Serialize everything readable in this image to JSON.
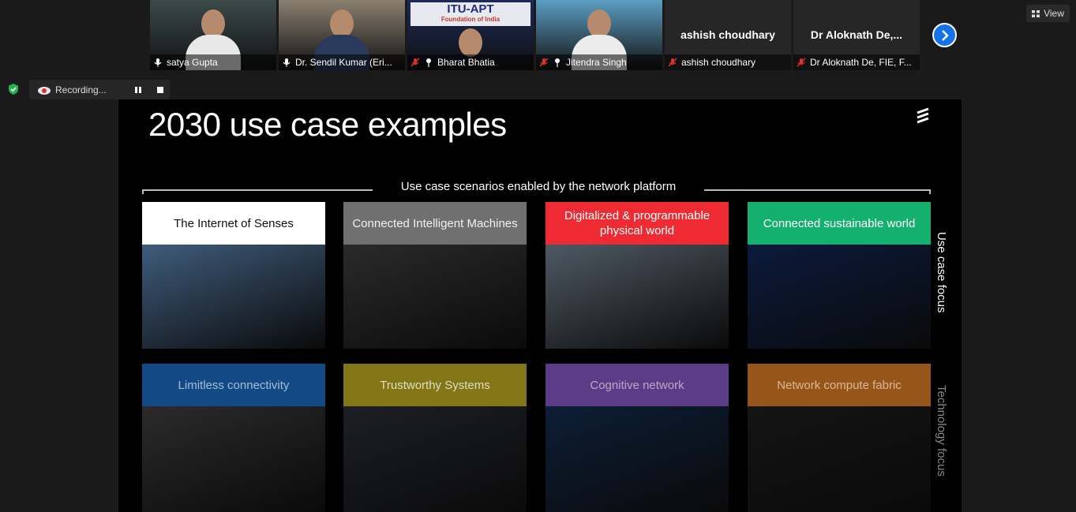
{
  "participants": [
    {
      "name": "satya Gupta",
      "type": "video",
      "active": true,
      "bg": "#3c4a4a",
      "shirt": "#e8e8e8"
    },
    {
      "name": "Dr. Sendil Kumar (Eri...",
      "type": "video",
      "active": false,
      "bg": "#8a8070",
      "shirt": "#2a3a5c"
    },
    {
      "name": "Bharat Bhatia",
      "type": "logo",
      "active": false,
      "logo_title": "ITU-APT",
      "logo_sub": "Foundation of India",
      "bg": "#1c2a5a",
      "shirt": "#444"
    },
    {
      "name": "Jitendra Singh",
      "type": "video",
      "active": false,
      "bg": "#5c9ec4",
      "shirt": "#ececec"
    },
    {
      "name": "ashish choudhary",
      "type": "name",
      "display": "ashish choudhary"
    },
    {
      "name": "Dr Aloknath De, FIE, F...",
      "type": "name",
      "display": "Dr  Aloknath De,..."
    }
  ],
  "view_label": "View",
  "recording_label": "Recording...",
  "slide": {
    "title": "2030 use case examples",
    "section_label": "Use case scenarios enabled by the network platform",
    "use_case_focus": "Use case focus",
    "technology_focus": "Technology focus",
    "top_cards": [
      {
        "label": "The Internet of Senses",
        "bg": "#ffffff",
        "fg": "#111111",
        "pic": "#3f5c7c"
      },
      {
        "label": "Connected Intelligent Machines",
        "bg": "#707070",
        "fg": "#f2f2f2",
        "pic": "#2a2a2a"
      },
      {
        "label": "Digitalized & programmable physical world",
        "bg": "#ee2b33",
        "fg": "#ffffff",
        "pic": "#4f5963"
      },
      {
        "label": "Connected sustainable world",
        "bg": "#14b06e",
        "fg": "#ffffff",
        "pic": "#0b1a3c"
      }
    ],
    "bottom_cards": [
      {
        "label": "Limitless connectivity",
        "bg": "#124a86",
        "fg": "#a4bed6",
        "pic": "#2c2a2a"
      },
      {
        "label": "Trustworthy Systems",
        "bg": "#827616",
        "fg": "#e0dcc0",
        "pic": "#1c1f24"
      },
      {
        "label": "Cognitive network",
        "bg": "#5c3c86",
        "fg": "#b8a8c8",
        "pic": "#0c1e36"
      },
      {
        "label": "Network compute fabric",
        "bg": "#96561a",
        "fg": "#d8b898",
        "pic": "#141414"
      }
    ]
  }
}
